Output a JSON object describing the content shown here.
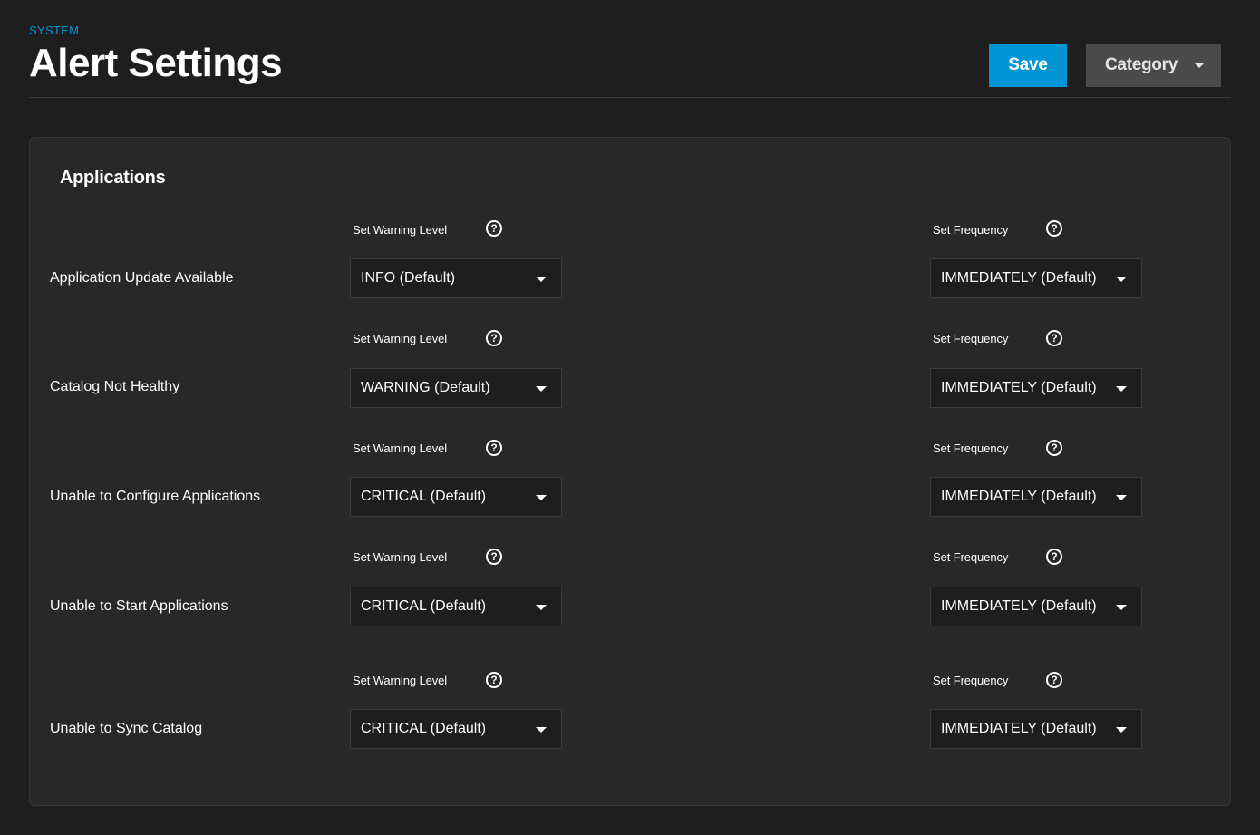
{
  "header": {
    "breadcrumb": "SYSTEM",
    "title": "Alert Settings",
    "save_label": "Save",
    "category_label": "Category"
  },
  "section": {
    "title": "Applications",
    "warning_label": "Set Warning Level",
    "frequency_label": "Set Frequency",
    "help_glyph": "?"
  },
  "alerts": [
    {
      "name": "Application Update Available",
      "level": "INFO (Default)",
      "frequency": "IMMEDIATELY (Default)"
    },
    {
      "name": "Catalog Not Healthy",
      "level": "WARNING (Default)",
      "frequency": "IMMEDIATELY (Default)"
    },
    {
      "name": "Unable to Configure Applications",
      "level": "CRITICAL (Default)",
      "frequency": "IMMEDIATELY (Default)"
    },
    {
      "name": "Unable to Start Applications",
      "level": "CRITICAL (Default)",
      "frequency": "IMMEDIATELY (Default)"
    },
    {
      "name": "Unable to Sync Catalog",
      "level": "CRITICAL (Default)",
      "frequency": "IMMEDIATELY (Default)"
    }
  ],
  "colors": {
    "accent": "#0095d5",
    "background": "#1e1e1f",
    "card": "#282828",
    "secondary_button": "#4a4a4a"
  },
  "icons": {
    "help": "help-circle-icon",
    "dropdown": "chevron-down-icon"
  }
}
